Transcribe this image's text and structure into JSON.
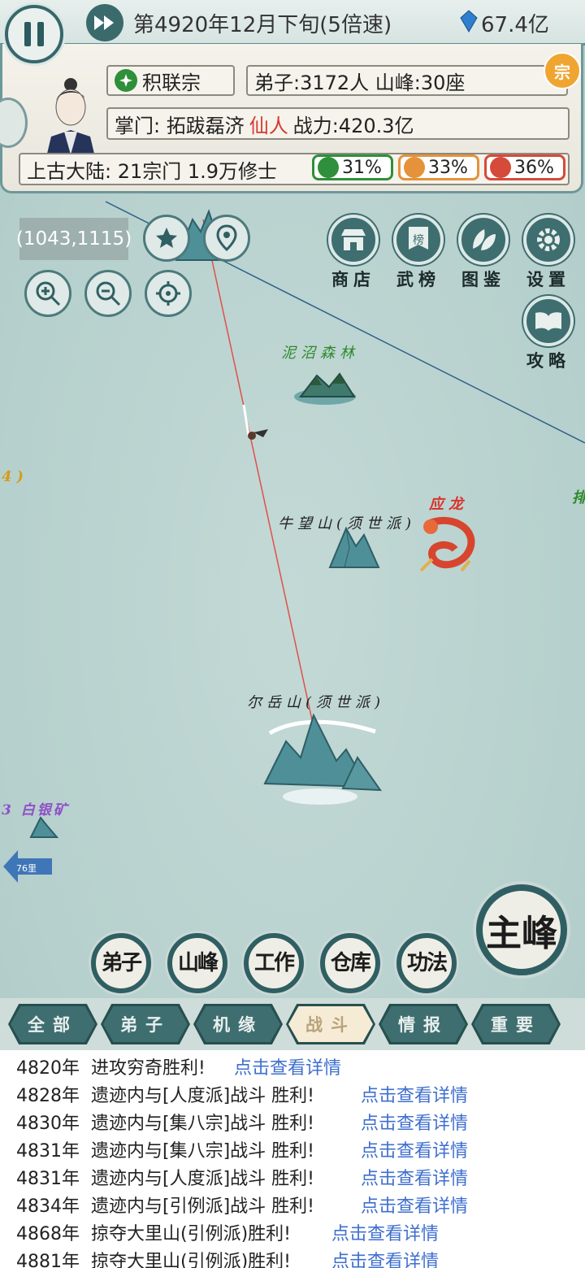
{
  "hud": {
    "date": "第4920年12月下旬(5倍速)",
    "spirit_stones": "67.4亿"
  },
  "sect": {
    "name": "积联宗",
    "disciples": "弟子:3172人 山峰:30座",
    "leader_prefix": "掌门: 拓跋磊济",
    "leader_rank": "仙人",
    "leader_power": "战力:420.3亿",
    "continent": "上古大陆: 21宗门 1.9万修士",
    "badge": "宗",
    "shares": [
      {
        "value": "31%",
        "color": "#2f8f3a"
      },
      {
        "value": "33%",
        "color": "#e5923a"
      },
      {
        "value": "36%",
        "color": "#d64a3a"
      }
    ]
  },
  "map": {
    "coords": "(1043,1115)",
    "labels": {
      "swamp": "泥沼森林",
      "niu_mountain": "牛望山(须世派)",
      "dragon": "应龙",
      "er_mountain": "尔岳山(须世派)",
      "mine": "3 白银矿",
      "edge_left": "4)",
      "edge_right": "排"
    },
    "distance_arrow": "76里"
  },
  "menu": {
    "shop": "商店",
    "ranking": "武榜",
    "ranking_icon_text": "榜",
    "atlas": "图鉴",
    "settings": "设置",
    "guide": "攻略"
  },
  "bottom_buttons": {
    "disciples": "弟子",
    "peaks": "山峰",
    "work": "工作",
    "warehouse": "仓库",
    "skills": "功法",
    "main_peak": "主峰"
  },
  "tabs": [
    "全部",
    "弟子",
    "机缘",
    "战斗",
    "情报",
    "重要"
  ],
  "active_tab": 3,
  "log": [
    {
      "year": "4820年",
      "text": "进攻穷奇胜利!",
      "link": "点击查看详情"
    },
    {
      "year": "4828年",
      "text": "遗迹内与[人度派]战斗 胜利!",
      "link": "点击查看详情"
    },
    {
      "year": "4830年",
      "text": "遗迹内与[集八宗]战斗 胜利!",
      "link": "点击查看详情"
    },
    {
      "year": "4831年",
      "text": "遗迹内与[集八宗]战斗 胜利!",
      "link": "点击查看详情"
    },
    {
      "year": "4831年",
      "text": "遗迹内与[人度派]战斗 胜利!",
      "link": "点击查看详情"
    },
    {
      "year": "4834年",
      "text": "遗迹内与[引例派]战斗 胜利!",
      "link": "点击查看详情"
    },
    {
      "year": "4868年",
      "text": "掠夺大里山(引例派)胜利!",
      "link": "点击查看详情"
    },
    {
      "year": "4881年",
      "text": "掠夺大里山(引例派)胜利!",
      "link": "点击查看详情"
    }
  ]
}
